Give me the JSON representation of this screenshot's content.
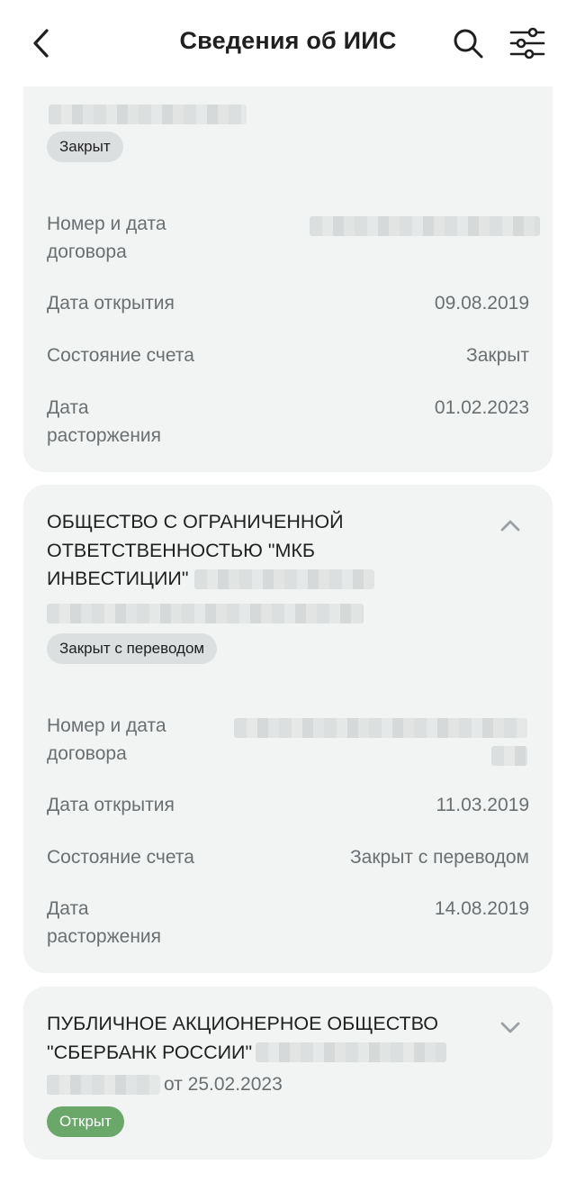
{
  "header": {
    "title": "Сведения об ИИС",
    "back_icon": "chevron-left-icon",
    "search_icon": "search-icon",
    "filter_icon": "sliders-icon"
  },
  "accounts": [
    {
      "status_badge": "Закрыт",
      "rows": [
        {
          "label": "Номер и дата договора",
          "value": ""
        },
        {
          "label": "Дата открытия",
          "value": "09.08.2019"
        },
        {
          "label": "Состояние счета",
          "value": "Закрыт"
        },
        {
          "label": "Дата расторжения",
          "value": "01.02.2023"
        }
      ]
    },
    {
      "title": "ОБЩЕСТВО С ОГРАНИЧЕННОЙ ОТВЕТСТВЕННОСТЬЮ \"МКБ ИНВЕСТИЦИИ\"",
      "expanded": true,
      "status_badge": "Закрыт с переводом",
      "rows": [
        {
          "label": "Номер и дата договора",
          "value": ""
        },
        {
          "label": "Дата открытия",
          "value": "11.03.2019"
        },
        {
          "label": "Состояние счета",
          "value": "Закрыт с переводом"
        },
        {
          "label": "Дата расторжения",
          "value": "14.08.2019"
        }
      ]
    },
    {
      "title": "ПУБЛИЧНОЕ АКЦИОНЕРНОЕ ОБЩЕСТВО \"СБЕРБАНК РОССИИ\"",
      "expanded": false,
      "date_text": "от 25.02.2023",
      "status_badge": "Открыт"
    }
  ],
  "colors": {
    "card_bg": "#f2f4f4",
    "badge_bg": "#dcdfe0",
    "open_badge_bg": "#6aa86a",
    "secondary_text": "#6a6f72"
  }
}
